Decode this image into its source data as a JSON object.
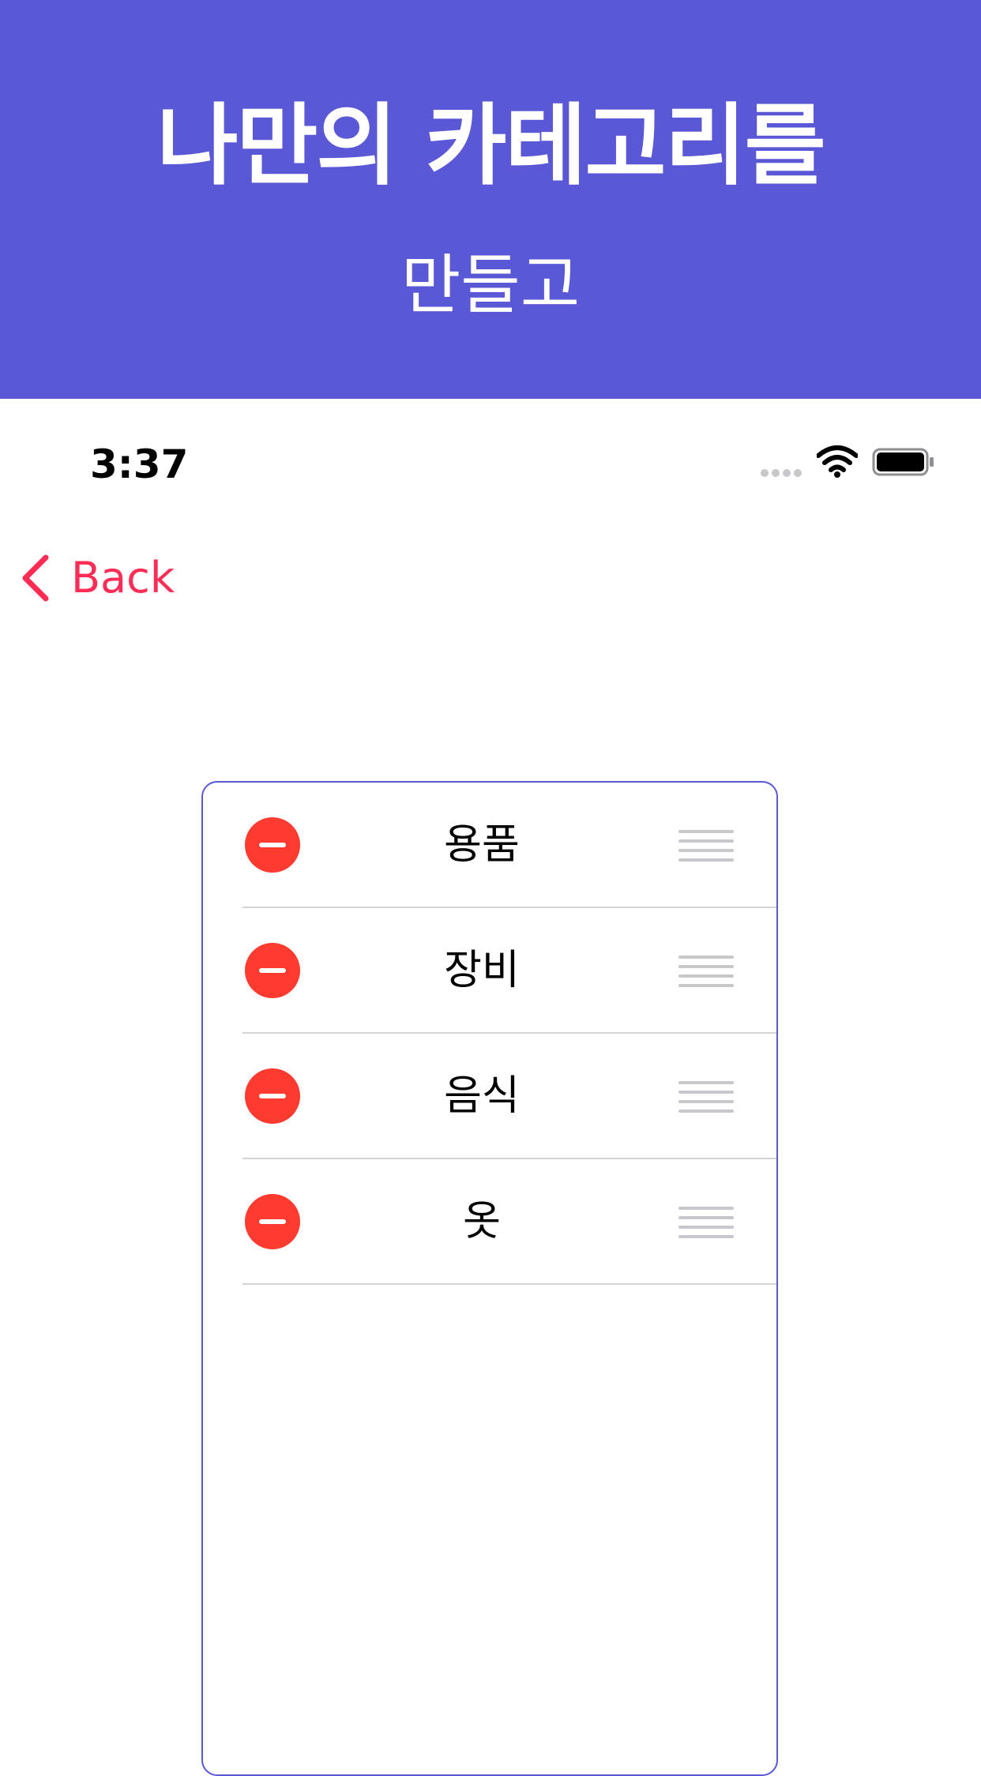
{
  "banner": {
    "title": "나만의 카테고리를",
    "subtitle": "만들고",
    "background_color": "#5a58d6"
  },
  "status_bar": {
    "time": "3:37",
    "icons": [
      "signal-dots-icon",
      "wifi-icon",
      "battery-icon"
    ]
  },
  "nav": {
    "back_label": "Back",
    "back_icon": "chevron-left-icon",
    "accent_color": "#ff2d55"
  },
  "categories": {
    "items": [
      {
        "label": "용품"
      },
      {
        "label": "장비"
      },
      {
        "label": "음식"
      },
      {
        "label": "옷"
      }
    ],
    "delete_icon": "minus-circle-icon",
    "reorder_icon": "drag-handle-icon",
    "delete_color": "#ff3b30",
    "border_color": "#5a58d6"
  }
}
